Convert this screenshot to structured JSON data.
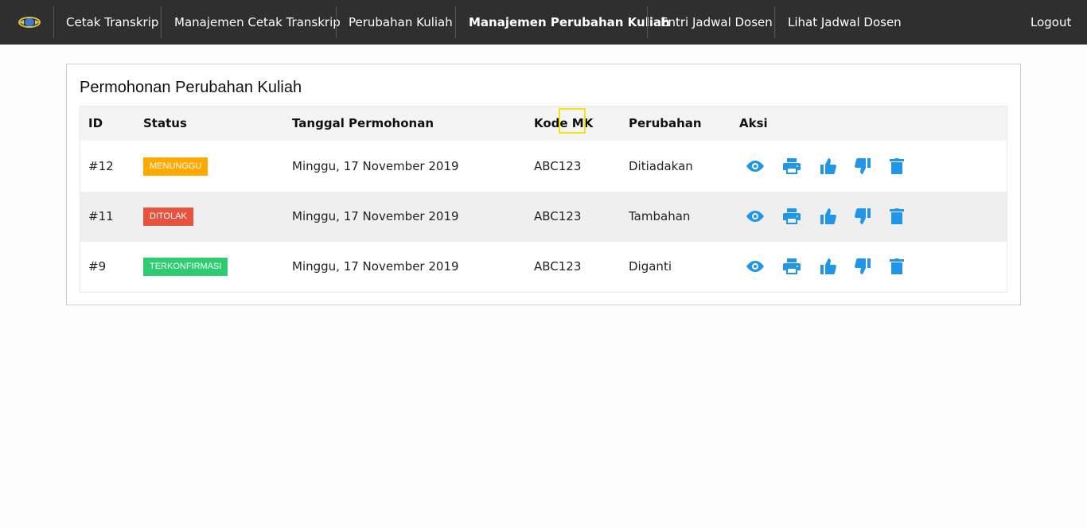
{
  "nav": {
    "items": [
      {
        "label": "Cetak Transkrip"
      },
      {
        "label": "Manajemen Cetak Transkrip"
      },
      {
        "label": "Perubahan Kuliah"
      },
      {
        "label": "Manajemen Perubahan Kuliah"
      },
      {
        "label": "Entri Jadwal Dosen"
      },
      {
        "label": "Lihat Jadwal Dosen"
      }
    ],
    "active": "Manajemen Perubahan Kuliah",
    "logout": "Logout"
  },
  "panel": {
    "title": "Permohonan Perubahan Kuliah"
  },
  "table": {
    "headers": [
      "ID",
      "Status",
      "Tanggal Permohonan",
      "Kode MK",
      "Perubahan",
      "Aksi"
    ],
    "rows": [
      {
        "id": "#12",
        "status": "MENUNGGU",
        "status_color": "#ffa800",
        "date": "Minggu, 17 November 2019",
        "code": "ABC123",
        "change": "Ditiadakan"
      },
      {
        "id": "#11",
        "status": "DITOLAK",
        "status_color": "#e8533f",
        "date": "Minggu, 17 November 2019",
        "code": "ABC123",
        "change": "Tambahan"
      },
      {
        "id": "#9",
        "status": "TERKONFIRMASI",
        "status_color": "#2ecc71",
        "date": "Minggu, 17 November 2019",
        "code": "ABC123",
        "change": "Diganti"
      }
    ],
    "actions": [
      "eye-icon",
      "print-icon",
      "thumbs-up-icon",
      "thumbs-down-icon",
      "trash-icon"
    ]
  },
  "colors": {
    "navbar": "#2f2f2f",
    "action_icon": "#2196e8",
    "highlight": "#f2e20d"
  }
}
